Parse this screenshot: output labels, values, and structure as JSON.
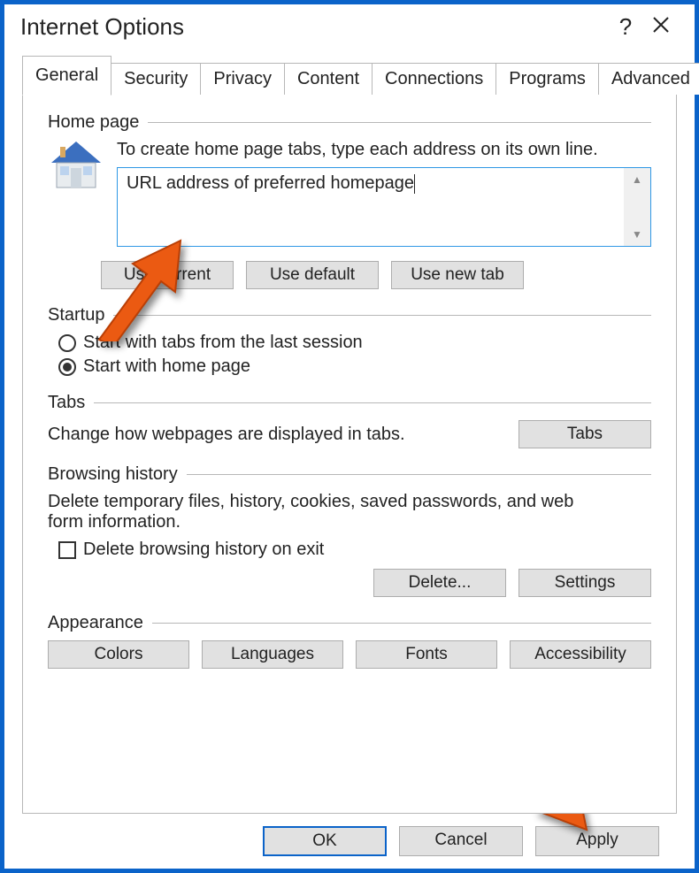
{
  "window": {
    "title": "Internet Options"
  },
  "tabs": {
    "items": [
      "General",
      "Security",
      "Privacy",
      "Content",
      "Connections",
      "Programs",
      "Advanced"
    ],
    "active": "General"
  },
  "home_page": {
    "group_label": "Home page",
    "instruction": "To create home page tabs, type each address on its own line.",
    "url_value": "URL address of preferred homepage",
    "use_current": "Use current",
    "use_default": "Use default",
    "use_new_tab": "Use new tab"
  },
  "startup": {
    "group_label": "Startup",
    "option_last_session": "Start with tabs from the last session",
    "option_home_page": "Start with home page",
    "selected": "home_page"
  },
  "tabs_section": {
    "group_label": "Tabs",
    "description": "Change how webpages are displayed in tabs.",
    "button": "Tabs"
  },
  "browsing_history": {
    "group_label": "Browsing history",
    "description": "Delete temporary files, history, cookies, saved passwords, and web form information.",
    "delete_on_exit": "Delete browsing history on exit",
    "delete_button": "Delete...",
    "settings_button": "Settings"
  },
  "appearance": {
    "group_label": "Appearance",
    "colors": "Colors",
    "languages": "Languages",
    "fonts": "Fonts",
    "accessibility": "Accessibility"
  },
  "dialog_buttons": {
    "ok": "OK",
    "cancel": "Cancel",
    "apply": "Apply"
  }
}
